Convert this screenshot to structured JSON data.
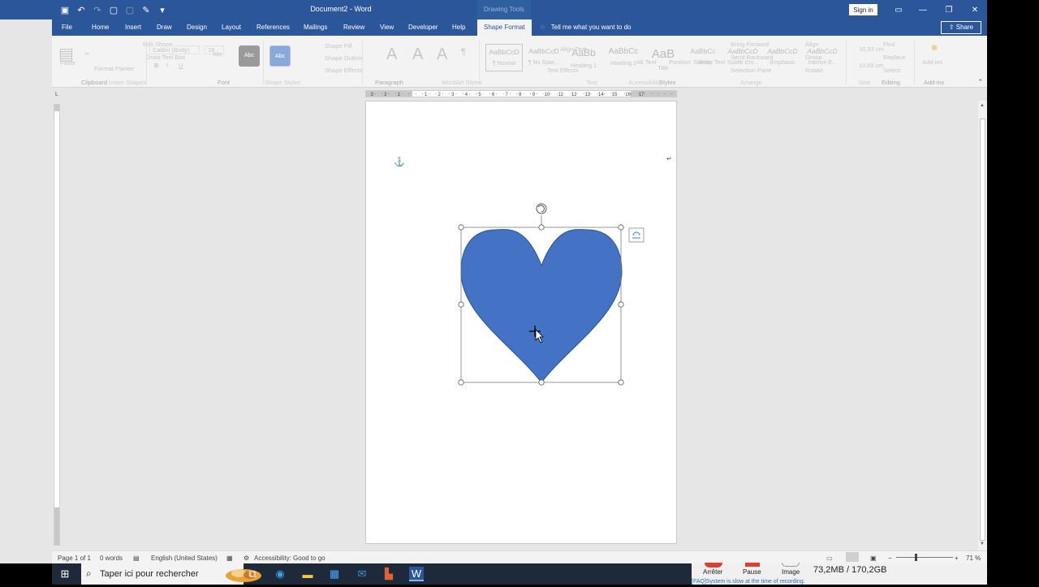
{
  "window": {
    "title": "Document2 - Word",
    "context_tab_title": "Drawing Tools",
    "sign_in": "Sign in"
  },
  "tabs": [
    "File",
    "Home",
    "Insert",
    "Draw",
    "Design",
    "Layout",
    "References",
    "Mailings",
    "Review",
    "View",
    "Developer",
    "Help",
    "Shape Format"
  ],
  "active_tab": "Shape Format",
  "tell_me": "Tell me what you want to do",
  "share_label": "Share",
  "ribbon": {
    "groups": [
      "Clipboard",
      "Insert Shapes",
      "Font",
      "Shape Styles",
      "Paragraph",
      "WordArt Styles",
      "Text",
      "Accessibility",
      "Styles",
      "Arrange",
      "Size",
      "Editing",
      "Add-ins"
    ],
    "clipboard": {
      "paste": "Paste",
      "format_painter": "Format Painter"
    },
    "font": {
      "name": "Calibri (Body)",
      "size": "18",
      "draw_text_box": "Draw Text Box",
      "edit_shape": "Edit Shape"
    },
    "shape_styles": {
      "fill": "Shape Fill",
      "outline": "Shape Outline",
      "effects": "Shape Effects",
      "abc": "Abc"
    },
    "text": {
      "align_text": "Align Text",
      "text_effects": "Text Effects",
      "alt_text": "Alt Text"
    },
    "styles": [
      {
        "preview": "AaBbCcD",
        "name": "¶ Normal"
      },
      {
        "preview": "AaBbCcD",
        "name": "¶ No Spac..."
      },
      {
        "preview": "AaBb",
        "name": "Heading 1"
      },
      {
        "preview": "AaBbCc",
        "name": "Heading 2"
      },
      {
        "preview": "AaB",
        "name": "Title"
      },
      {
        "preview": "AaBbCc",
        "name": "Subtitle"
      },
      {
        "preview": "AaBbCcD",
        "name": "Subtle Em..."
      },
      {
        "preview": "AaBbCcD",
        "name": "Emphasis"
      },
      {
        "preview": "AaBbCcD",
        "name": "Intense E..."
      }
    ],
    "arrange": {
      "bring_forward": "Bring Forward",
      "send_backward": "Send Backward",
      "selection_pane": "Selection Pane",
      "position": "Position",
      "wrap_text": "Wrap Text",
      "align": "Align",
      "group": "Group",
      "rotate": "Rotate"
    },
    "size": {
      "height": "10,33 cm",
      "width": "10,65 cm"
    },
    "editing": {
      "find": "Find",
      "replace": "Replace",
      "select": "Select"
    },
    "addins": "Add-ins"
  },
  "ruler": {
    "labels": [
      "3",
      "2",
      "1",
      "1",
      "2",
      "3",
      "4",
      "5",
      "6",
      "7",
      "8",
      "9",
      "10",
      "11",
      "12",
      "13",
      "14",
      "15",
      "16",
      "17"
    ],
    "vertical_corner": "L"
  },
  "shape": {
    "fill": "#4472c4",
    "outline": "#2f528f"
  },
  "statusbar": {
    "page": "Page 1 of 1",
    "words": "0 words",
    "language": "English (United States)",
    "accessibility": "Accessibility: Good to go",
    "zoom": "71 %"
  },
  "taskbar": {
    "search_placeholder": "Taper ici pour rechercher"
  },
  "recorder": {
    "stop": "Arrêter",
    "pause": "Pause",
    "image": "Image",
    "memory": "73,2MB / 170,2GB",
    "message": "[FAQ]System is slow at the time of recording."
  },
  "colors": {
    "word_blue": "#2b579a",
    "shape_blue": "#4472c4"
  }
}
